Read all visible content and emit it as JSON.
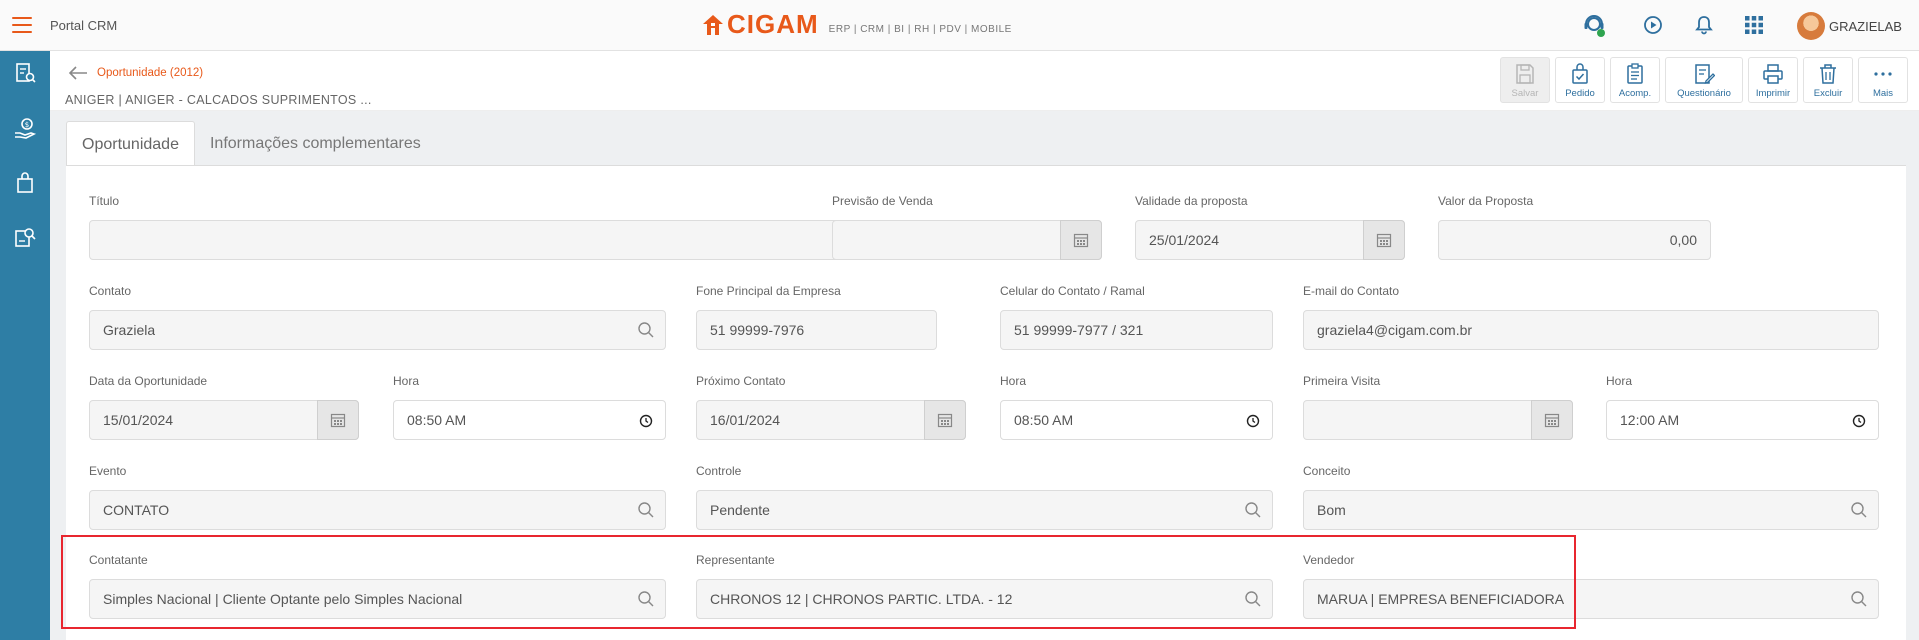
{
  "app": {
    "portal_title": "Portal CRM",
    "logo_text": "CIGAM",
    "logo_subtitle": "ERP | CRM | BI | RH | PDV | MOBILE",
    "username": "GRAZIELAB",
    "accent_color": "#e8591a",
    "sidebar_color": "#2e7ea5"
  },
  "header": {
    "breadcrumb": "Oportunidade (2012)",
    "record_title": "ANIGER | ANIGER - CALCADOS SUPRIMENTOS ...",
    "toolbar": [
      {
        "label": "Salvar",
        "icon": "save-icon"
      },
      {
        "label": "Pedido",
        "icon": "bag-check-icon"
      },
      {
        "label": "Acomp.",
        "icon": "clipboard-icon"
      },
      {
        "label": "Questionário",
        "icon": "form-edit-icon"
      },
      {
        "label": "Imprimir",
        "icon": "printer-icon"
      },
      {
        "label": "Excluir",
        "icon": "trash-icon"
      },
      {
        "label": "Mais",
        "icon": "more-icon"
      }
    ]
  },
  "tabs": [
    {
      "label": "Oportunidade"
    },
    {
      "label": "Informações complementares"
    }
  ],
  "form": {
    "titulo": {
      "label": "Título",
      "value": ""
    },
    "previsao_venda": {
      "label": "Previsão de Venda",
      "value": ""
    },
    "validade_proposta": {
      "label": "Validade da proposta",
      "value": "25/01/2024"
    },
    "valor_proposta": {
      "label": "Valor da Proposta",
      "value": "0,00"
    },
    "contato": {
      "label": "Contato",
      "value": "Graziela"
    },
    "fone_empresa": {
      "label": "Fone Principal da Empresa",
      "value": "51 99999-7976"
    },
    "celular_contato": {
      "label": "Celular do Contato / Ramal",
      "value": "51 99999-7977 / 321"
    },
    "email_contato": {
      "label": "E-mail do Contato",
      "value": "graziela4@cigam.com.br"
    },
    "data_oportunidade": {
      "label": "Data da Oportunidade",
      "value": "15/01/2024"
    },
    "hora_oportunidade": {
      "label": "Hora",
      "value": "08:50  AM"
    },
    "proximo_contato": {
      "label": "Próximo Contato",
      "value": "16/01/2024"
    },
    "hora_proximo": {
      "label": "Hora",
      "value": "08:50  AM"
    },
    "primeira_visita": {
      "label": "Primeira Visita",
      "value": ""
    },
    "hora_visita": {
      "label": "Hora",
      "value": "12:00  AM"
    },
    "evento": {
      "label": "Evento",
      "value": "CONTATO"
    },
    "controle": {
      "label": "Controle",
      "value": "Pendente"
    },
    "conceito": {
      "label": "Conceito",
      "value": "Bom"
    },
    "contatante": {
      "label": "Contatante",
      "value": "Simples Nacional | Cliente Optante pelo Simples Nacional"
    },
    "representante": {
      "label": "Representante",
      "value": "CHRONOS 12 | CHRONOS PARTIC. LTDA. - 12"
    },
    "vendedor": {
      "label": "Vendedor",
      "value": "MARUA | EMPRESA BENEFICIADORA"
    }
  }
}
